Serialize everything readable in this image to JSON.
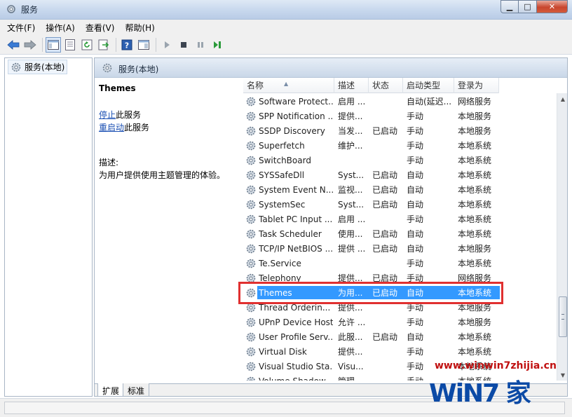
{
  "window": {
    "title": "服务"
  },
  "menu": [
    "文件(F)",
    "操作(A)",
    "查看(V)",
    "帮助(H)"
  ],
  "tree": {
    "root": "服务(本地)"
  },
  "pane_header": "服务(本地)",
  "details": {
    "service_name": "Themes",
    "action_stop_link": "停止",
    "action_stop_suffix": "此服务",
    "action_restart_link": "重启动",
    "action_restart_suffix": "此服务",
    "desc_label": "描述:",
    "desc_text": "为用户提供使用主题管理的体验。"
  },
  "columns": [
    "名称",
    "描述",
    "状态",
    "启动类型",
    "登录为"
  ],
  "rows": [
    {
      "name": "Software Protect...",
      "desc": "启用 ...",
      "status": "",
      "start": "自动(延迟...",
      "logon": "网络服务"
    },
    {
      "name": "SPP Notification ...",
      "desc": "提供...",
      "status": "",
      "start": "手动",
      "logon": "本地服务"
    },
    {
      "name": "SSDP Discovery",
      "desc": "当发...",
      "status": "已启动",
      "start": "手动",
      "logon": "本地服务"
    },
    {
      "name": "Superfetch",
      "desc": "维护...",
      "status": "",
      "start": "手动",
      "logon": "本地系统"
    },
    {
      "name": "SwitchBoard",
      "desc": "",
      "status": "",
      "start": "手动",
      "logon": "本地系统"
    },
    {
      "name": "SYSSafeDll",
      "desc": "Syst...",
      "status": "已启动",
      "start": "自动",
      "logon": "本地系统"
    },
    {
      "name": "System Event N...",
      "desc": "监视...",
      "status": "已启动",
      "start": "自动",
      "logon": "本地系统"
    },
    {
      "name": "SystemSec",
      "desc": "Syst...",
      "status": "已启动",
      "start": "自动",
      "logon": "本地系统"
    },
    {
      "name": "Tablet PC Input ...",
      "desc": "启用 ...",
      "status": "",
      "start": "手动",
      "logon": "本地系统"
    },
    {
      "name": "Task Scheduler",
      "desc": "使用...",
      "status": "已启动",
      "start": "自动",
      "logon": "本地系统"
    },
    {
      "name": "TCP/IP NetBIOS ...",
      "desc": "提供 ...",
      "status": "已启动",
      "start": "自动",
      "logon": "本地服务"
    },
    {
      "name": "Te.Service",
      "desc": "",
      "status": "",
      "start": "手动",
      "logon": "本地系统"
    },
    {
      "name": "Telephony",
      "desc": "提供...",
      "status": "已启动",
      "start": "手动",
      "logon": "网络服务"
    },
    {
      "name": "Themes",
      "desc": "为用...",
      "status": "已启动",
      "start": "自动",
      "logon": "本地系统",
      "selected": true
    },
    {
      "name": "Thread Orderin...",
      "desc": "提供...",
      "status": "",
      "start": "手动",
      "logon": "本地服务"
    },
    {
      "name": "UPnP Device Host",
      "desc": "允许 ...",
      "status": "",
      "start": "手动",
      "logon": "本地服务"
    },
    {
      "name": "User Profile Serv...",
      "desc": "此服...",
      "status": "已启动",
      "start": "自动",
      "logon": "本地系统"
    },
    {
      "name": "Virtual Disk",
      "desc": "提供...",
      "status": "",
      "start": "手动",
      "logon": "本地系统"
    },
    {
      "name": "Visual Studio Sta...",
      "desc": "Visu...",
      "status": "",
      "start": "手动",
      "logon": "本地系统"
    },
    {
      "name": "Volume Shadow...",
      "desc": "管理...",
      "status": "",
      "start": "手动",
      "logon": "本地系统"
    }
  ],
  "tabs": [
    "扩展",
    "标准"
  ],
  "watermark": {
    "url": "www.winwin7zhijia.cn",
    "logo": "WiN7 家"
  },
  "colors": {
    "selection": "#3399ff",
    "highlight_border": "#e03030",
    "link": "#1a4fb3"
  }
}
